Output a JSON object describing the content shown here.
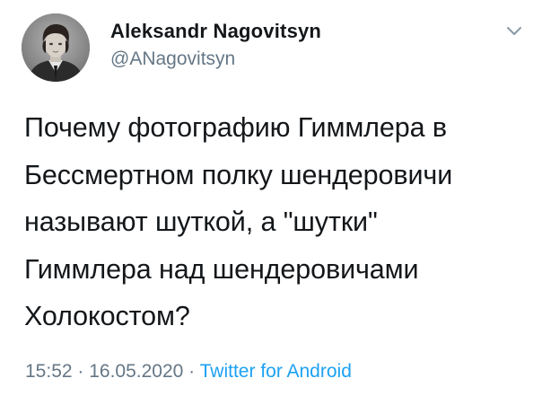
{
  "author": {
    "display_name": "Aleksandr Nagovitsyn",
    "handle": "@ANagovitsyn"
  },
  "tweet": {
    "text": "Почему фотографию Гиммлера в\nБессмертном полку шендеровичи\nназывают шуткой, а \"шутки\"\nГиммлера над шендеровичами\nХолокостом?"
  },
  "meta": {
    "time": "15:52",
    "separator": " · ",
    "date": "16.05.2020",
    "source": "Twitter for Android"
  },
  "icons": {
    "menu": "chevron-down-icon"
  },
  "colors": {
    "text": "#14171a",
    "secondary": "#657786",
    "accent": "#1da1f2"
  }
}
